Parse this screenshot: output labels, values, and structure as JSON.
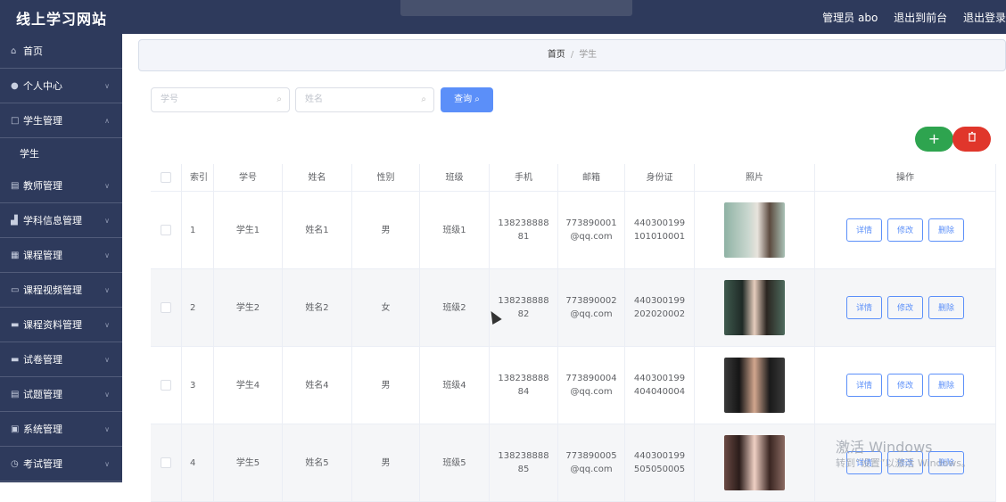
{
  "header": {
    "title": "线上学习网站",
    "admin_label": "管理员 abo",
    "back_frontend": "退出到前台",
    "logout": "退出登录"
  },
  "sidebar": {
    "items": [
      {
        "label": "首页"
      },
      {
        "label": "个人中心"
      },
      {
        "label": "学生管理"
      },
      {
        "label": "教师管理"
      },
      {
        "label": "学科信息管理"
      },
      {
        "label": "课程管理"
      },
      {
        "label": "课程视频管理"
      },
      {
        "label": "课程资料管理"
      },
      {
        "label": "试卷管理"
      },
      {
        "label": "试题管理"
      },
      {
        "label": "系统管理"
      },
      {
        "label": "考试管理"
      }
    ],
    "sub_item": "学生"
  },
  "breadcrumb": {
    "home": "首页",
    "separator": "/",
    "current": "学生"
  },
  "search": {
    "student_no_placeholder": "学号",
    "name_placeholder": "姓名",
    "query_label": "查询"
  },
  "actions": {
    "add": "+",
    "delete": "删"
  },
  "table": {
    "headers": [
      "索引",
      "学号",
      "姓名",
      "性别",
      "班级",
      "手机",
      "邮箱",
      "身份证",
      "照片",
      "操作"
    ],
    "op_labels": {
      "detail": "详情",
      "edit": "修改",
      "delete": "删除"
    },
    "rows": [
      {
        "idx": "1",
        "no": "学生1",
        "name": "姓名1",
        "sex": "男",
        "cls": "班级1",
        "phone": "13823888881",
        "mail": "773890001@qq.com",
        "id": "440300199101010001"
      },
      {
        "idx": "2",
        "no": "学生2",
        "name": "姓名2",
        "sex": "女",
        "cls": "班级2",
        "phone": "13823888882",
        "mail": "773890002@qq.com",
        "id": "440300199202020002"
      },
      {
        "idx": "3",
        "no": "学生4",
        "name": "姓名4",
        "sex": "男",
        "cls": "班级4",
        "phone": "13823888884",
        "mail": "773890004@qq.com",
        "id": "440300199404040004"
      },
      {
        "idx": "4",
        "no": "学生5",
        "name": "姓名5",
        "sex": "男",
        "cls": "班级5",
        "phone": "13823888885",
        "mail": "773890005@qq.com",
        "id": "440300199505050005"
      }
    ]
  },
  "watermark": {
    "line1": "激活 Windows",
    "line2": "转到“设置”以激活 Windows。"
  }
}
